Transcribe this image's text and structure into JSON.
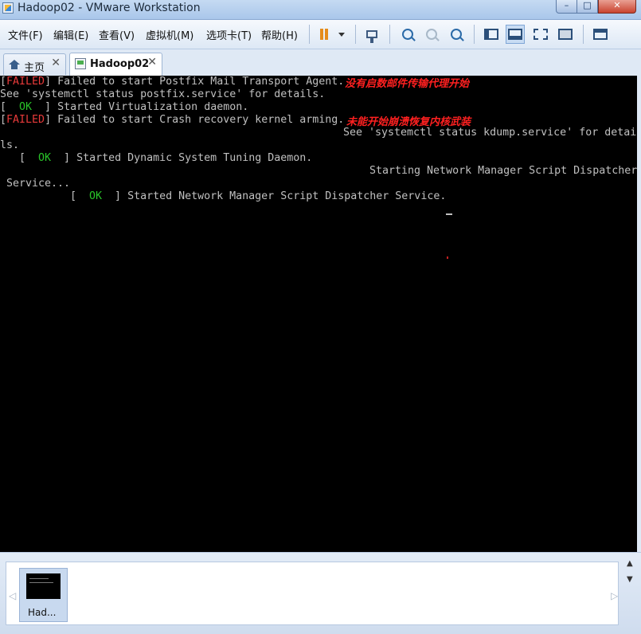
{
  "window": {
    "title": "Hadoop02 - VMware Workstation",
    "controls": {
      "minimize": "–",
      "maximize": "□",
      "close": "✕"
    }
  },
  "menu": {
    "file": "文件(F)",
    "edit": "编辑(E)",
    "view": "查看(V)",
    "vm": "虚拟机(M)",
    "tabs": "选项卡(T)",
    "help": "帮助(H)"
  },
  "toolbar": {
    "icons": [
      "pause-icon",
      "pause-dropdown-icon",
      "send-ctrl-alt-del-icon",
      "snapshot-take-icon",
      "snapshot-revert-icon",
      "snapshot-manager-icon",
      "library-view-icon",
      "normal-view-icon",
      "fullscreen-icon",
      "unity-icon",
      "console-view-icon"
    ],
    "accent": "#e58c1c"
  },
  "tabs": [
    {
      "label": "主页",
      "close": "✕",
      "active": false
    },
    {
      "label": "Hadoop02",
      "close": "✕",
      "active": true
    }
  ],
  "console": {
    "colors": {
      "text": "#c0c0c0",
      "failed": "#e83a3a",
      "ok": "#29c529",
      "annotation": "#ff2020"
    },
    "lines": [
      {
        "pre": "[",
        "status": "FAILED",
        "post": "] Failed to start Postfix Mail Transport Agent."
      },
      {
        "text": "See 'systemctl status postfix.service' for details."
      },
      {
        "pre": "[  ",
        "status": "OK",
        "post": "  ] Started Virtualization daemon."
      },
      {
        "pre": "[",
        "status": "FAILED",
        "post": "] Failed to start Crash recovery kernel arming."
      },
      {
        "text": "See 'systemctl status kdump.service' for detai"
      },
      {
        "text": "ls."
      },
      {
        "pre": "[  ",
        "status": "OK",
        "post": "  ] Started Dynamic System Tuning Daemon."
      },
      {
        "text": "Starting Network Manager Script Dispatcher"
      },
      {
        "text": "Service..."
      },
      {
        "pre": "[  ",
        "status": "OK",
        "post": "  ] Started Network Manager Script Dispatcher Service."
      }
    ],
    "annotations": {
      "postfix": "没有启数邮件传输代理开始",
      "kdump": "未能开始崩溃恢复内核武装"
    }
  },
  "thumbnails": {
    "items": [
      {
        "label": "Had..."
      }
    ],
    "left_arrow": "◁",
    "right_arrow": "▷"
  },
  "scrollbar": {
    "up": "▲",
    "down": "▼"
  }
}
